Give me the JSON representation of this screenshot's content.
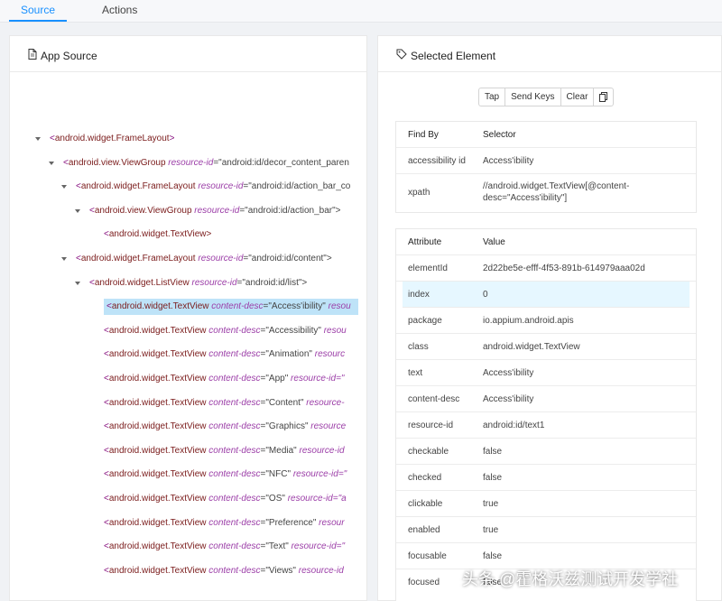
{
  "tabs": [
    {
      "label": "Source"
    },
    {
      "label": "Actions"
    }
  ],
  "app_source": {
    "title": "App Source"
  },
  "tree": {
    "nodes": [
      {
        "tag": "android.widget.FrameLayout",
        "attr": "",
        "val": ""
      },
      {
        "tag": "android.view.ViewGroup",
        "attr": "resource-id",
        "val": "=\"android:id/decor_content_paren"
      },
      {
        "tag": "android.widget.FrameLayout",
        "attr": "resource-id",
        "val": "=\"android:id/action_bar_co"
      },
      {
        "tag": "android.view.ViewGroup",
        "attr": "resource-id",
        "val": "=\"android:id/action_bar\">"
      },
      {
        "tag": "android.widget.TextView>",
        "attr": "",
        "val": ""
      },
      {
        "tag": "android.widget.FrameLayout",
        "attr": "resource-id",
        "val": "=\"android:id/content\">"
      },
      {
        "tag": "android.widget.ListView",
        "attr": "resource-id",
        "val": "=\"android:id/list\">"
      },
      {
        "tag": "android.widget.TextView",
        "attr": "content-desc",
        "val": "=\"Access'ibility\"",
        "tail": "resou"
      },
      {
        "tag": "android.widget.TextView",
        "attr": "content-desc",
        "val": "=\"Accessibility\"",
        "tail": "resou"
      },
      {
        "tag": "android.widget.TextView",
        "attr": "content-desc",
        "val": "=\"Animation\"",
        "tail": "resourc"
      },
      {
        "tag": "android.widget.TextView",
        "attr": "content-desc",
        "val": "=\"App\"",
        "tail": "resource-id=\""
      },
      {
        "tag": "android.widget.TextView",
        "attr": "content-desc",
        "val": "=\"Content\"",
        "tail": "resource-"
      },
      {
        "tag": "android.widget.TextView",
        "attr": "content-desc",
        "val": "=\"Graphics\"",
        "tail": "resource"
      },
      {
        "tag": "android.widget.TextView",
        "attr": "content-desc",
        "val": "=\"Media\"",
        "tail": "resource-id"
      },
      {
        "tag": "android.widget.TextView",
        "attr": "content-desc",
        "val": "=\"NFC\"",
        "tail": "resource-id=\""
      },
      {
        "tag": "android.widget.TextView",
        "attr": "content-desc",
        "val": "=\"OS\"",
        "tail": "resource-id=\"a"
      },
      {
        "tag": "android.widget.TextView",
        "attr": "content-desc",
        "val": "=\"Preference\"",
        "tail": "resour"
      },
      {
        "tag": "android.widget.TextView",
        "attr": "content-desc",
        "val": "=\"Text\"",
        "tail": "resource-id=\""
      },
      {
        "tag": "android.widget.TextView",
        "attr": "content-desc",
        "val": "=\"Views\"",
        "tail": "resource-id"
      }
    ]
  },
  "selected": {
    "title": "Selected Element",
    "buttons": {
      "tap": "Tap",
      "send_keys": "Send Keys",
      "clear": "Clear"
    },
    "find_by": {
      "header": [
        "Find By",
        "Selector"
      ],
      "rows": [
        [
          "accessibility id",
          "Access'ibility"
        ],
        [
          "xpath",
          "//android.widget.TextView[@content-desc=\"Access'ibility\"]"
        ]
      ]
    },
    "attributes": {
      "header": [
        "Attribute",
        "Value"
      ],
      "rows": [
        [
          "elementId",
          "2d22be5e-efff-4f53-891b-614979aaa02d"
        ],
        [
          "index",
          "0"
        ],
        [
          "package",
          "io.appium.android.apis"
        ],
        [
          "class",
          "android.widget.TextView"
        ],
        [
          "text",
          "Access'ibility"
        ],
        [
          "content-desc",
          "Access'ibility"
        ],
        [
          "resource-id",
          "android:id/text1"
        ],
        [
          "checkable",
          "false"
        ],
        [
          "checked",
          "false"
        ],
        [
          "clickable",
          "true"
        ],
        [
          "enabled",
          "true"
        ],
        [
          "focusable",
          "false"
        ],
        [
          "focused",
          "false"
        ]
      ]
    }
  },
  "watermark": "头条 @霍格沃兹测试开发学社",
  "colors": {
    "accent": "#1890ff",
    "selected_row": "#bee3f8",
    "highlight_row": "#e6f7ff"
  }
}
